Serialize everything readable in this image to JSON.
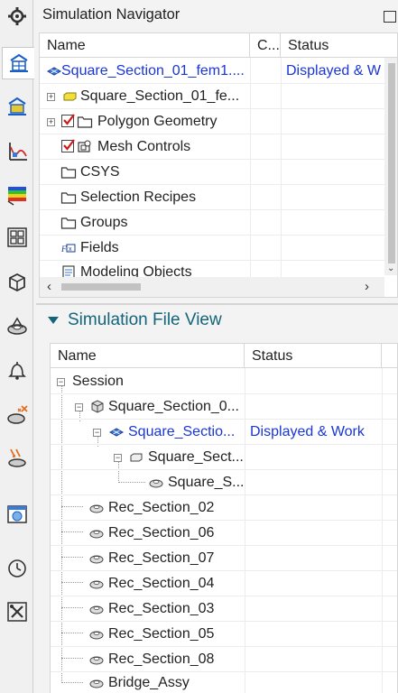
{
  "navigator": {
    "title": "Simulation Navigator",
    "columns": {
      "name": "Name",
      "c": "C...",
      "status": "Status"
    },
    "rows": [
      {
        "name": "Square_Section_01_fem1....",
        "status": "Displayed & W",
        "highlight": true
      },
      {
        "name": "Square_Section_01_fe...",
        "status": ""
      },
      {
        "name": "Polygon Geometry",
        "status": ""
      },
      {
        "name": "Mesh Controls",
        "status": ""
      },
      {
        "name": "CSYS",
        "status": ""
      },
      {
        "name": "Selection Recipes",
        "status": ""
      },
      {
        "name": "Groups",
        "status": ""
      },
      {
        "name": "Fields",
        "status": ""
      },
      {
        "name": "Modeling Objects",
        "status": ""
      }
    ]
  },
  "file_view": {
    "title": "Simulation File View",
    "columns": {
      "name": "Name",
      "status": "Status"
    },
    "rows": [
      {
        "name": "Session",
        "status": ""
      },
      {
        "name": "Square_Section_0...",
        "status": ""
      },
      {
        "name": "Square_Sectio...",
        "status": "Displayed & Work",
        "highlight": true
      },
      {
        "name": "Square_Sect...",
        "status": ""
      },
      {
        "name": "Square_S...",
        "status": ""
      },
      {
        "name": "Rec_Section_02",
        "status": ""
      },
      {
        "name": "Rec_Section_06",
        "status": ""
      },
      {
        "name": "Rec_Section_07",
        "status": ""
      },
      {
        "name": "Rec_Section_04",
        "status": ""
      },
      {
        "name": "Rec_Section_03",
        "status": ""
      },
      {
        "name": "Rec_Section_05",
        "status": ""
      },
      {
        "name": "Rec_Section_08",
        "status": ""
      },
      {
        "name": "Bridge_Assy",
        "status": ""
      }
    ]
  },
  "leftbar": [
    "gear-icon",
    "simulation-navigator-icon",
    "fem-navigator-icon",
    "xy-graph-icon",
    "color-bar-icon",
    "grid-icon",
    "part-icon",
    "mesh-icon",
    "bell-icon",
    "constraint-icon",
    "load-icon",
    "browser-icon",
    "clock-icon",
    "tools-icon"
  ],
  "colors": {
    "accent": "#14657a",
    "link_blue": "#1a35d8",
    "check_red": "#d01818"
  }
}
